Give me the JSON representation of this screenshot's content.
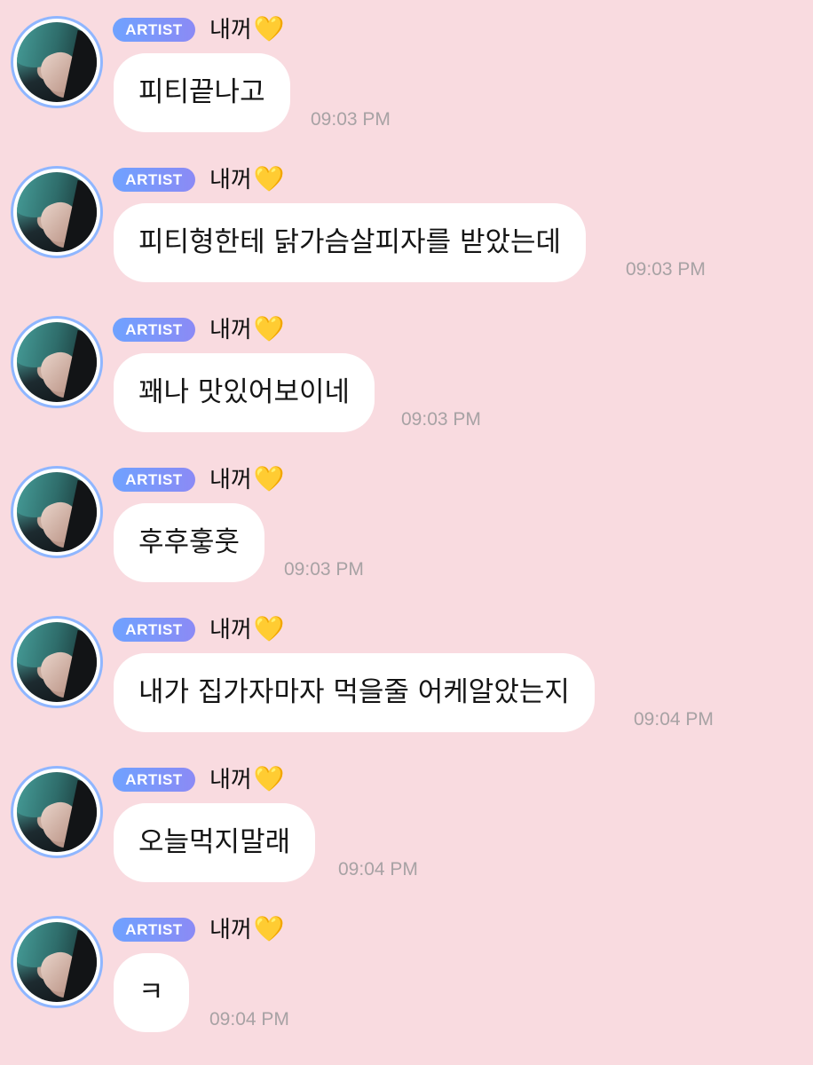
{
  "chat": {
    "badge_label": "ARTIST",
    "accent_colors": {
      "background": "#f9dbe0",
      "badge_gradient_start": "#6fa2ff",
      "badge_gradient_end": "#8b8af5",
      "avatar_ring": "#8fb6ff",
      "bubble": "#ffffff",
      "timestamp": "#a7a2a4",
      "heart": "#ffc83d"
    },
    "messages": [
      {
        "sender": "내꺼",
        "heart_icon": "yellow-heart-icon",
        "heart": "💛",
        "text": "피티끝나고",
        "time": "09:03 PM"
      },
      {
        "sender": "내꺼",
        "heart_icon": "yellow-heart-icon",
        "heart": "💛",
        "text": "피티형한테 닭가슴살피자를 받았는데",
        "time": "09:03 PM"
      },
      {
        "sender": "내꺼",
        "heart_icon": "yellow-heart-icon",
        "heart": "💛",
        "text": "꽤나 맛있어보이네",
        "time": "09:03 PM"
      },
      {
        "sender": "내꺼",
        "heart_icon": "yellow-heart-icon",
        "heart": "💛",
        "text": "후후훟훗",
        "time": "09:03 PM"
      },
      {
        "sender": "내꺼",
        "heart_icon": "yellow-heart-icon",
        "heart": "💛",
        "text": "내가 집가자마자 먹을줄 어케알았는지",
        "time": "09:04 PM"
      },
      {
        "sender": "내꺼",
        "heart_icon": "yellow-heart-icon",
        "heart": "💛",
        "text": "오늘먹지말래",
        "time": "09:04 PM"
      },
      {
        "sender": "내꺼",
        "heart_icon": "yellow-heart-icon",
        "heart": "💛",
        "text": "ㅋ",
        "time": "09:04 PM"
      }
    ]
  }
}
